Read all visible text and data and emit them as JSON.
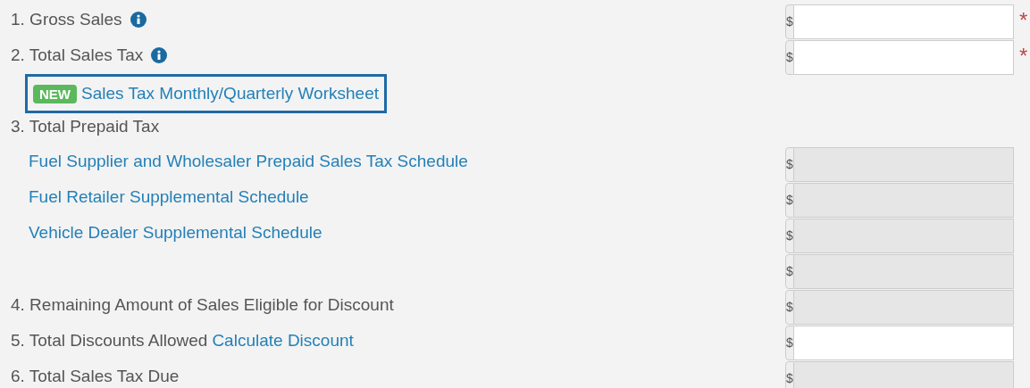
{
  "rows": [
    {
      "indented": false,
      "highlighted": false,
      "parts": [
        {
          "kind": "text",
          "text": "1. Gross Sales"
        },
        {
          "kind": "info"
        }
      ],
      "field": {
        "addon": "$",
        "disabled": false,
        "required_mark": "*"
      }
    },
    {
      "indented": false,
      "highlighted": false,
      "parts": [
        {
          "kind": "text",
          "text": "2. Total Sales Tax"
        },
        {
          "kind": "info"
        }
      ],
      "field": {
        "addon": "$",
        "disabled": false,
        "required_mark": "*"
      }
    },
    {
      "indented": true,
      "highlighted": true,
      "parts": [
        {
          "kind": "badge",
          "text": "NEW"
        },
        {
          "kind": "link",
          "text": "Sales Tax Monthly/Quarterly Worksheet"
        }
      ]
    },
    {
      "indented": false,
      "highlighted": false,
      "parts": [
        {
          "kind": "text",
          "text": "3. Total Prepaid Tax"
        }
      ]
    },
    {
      "indented": true,
      "highlighted": false,
      "parts": [
        {
          "kind": "link",
          "text": "Fuel Supplier and Wholesaler Prepaid Sales Tax Schedule"
        }
      ],
      "field": {
        "addon": "$",
        "disabled": true
      }
    },
    {
      "indented": true,
      "highlighted": false,
      "parts": [
        {
          "kind": "link",
          "text": "Fuel Retailer Supplemental Schedule"
        }
      ],
      "field": {
        "addon": "$",
        "disabled": true
      }
    },
    {
      "indented": true,
      "highlighted": false,
      "parts": [
        {
          "kind": "link",
          "text": "Vehicle Dealer Supplemental Schedule"
        }
      ],
      "field": {
        "addon": "$",
        "disabled": true
      }
    },
    {
      "indented": false,
      "highlighted": false,
      "parts": [],
      "field": {
        "addon": "$",
        "disabled": true
      }
    },
    {
      "indented": false,
      "highlighted": false,
      "parts": [
        {
          "kind": "text",
          "text": "4. Remaining Amount of Sales Eligible for Discount"
        }
      ],
      "field": {
        "addon": "$",
        "disabled": true
      }
    },
    {
      "indented": false,
      "highlighted": false,
      "parts": [
        {
          "kind": "text",
          "text": "5. Total Discounts Allowed"
        },
        {
          "kind": "link",
          "text": "Calculate Discount"
        }
      ],
      "field": {
        "addon": "$",
        "disabled": false
      }
    },
    {
      "indented": false,
      "highlighted": false,
      "parts": [
        {
          "kind": "text",
          "text": "6. Total Sales Tax Due"
        }
      ],
      "field": {
        "addon": "$",
        "disabled": true
      }
    }
  ]
}
